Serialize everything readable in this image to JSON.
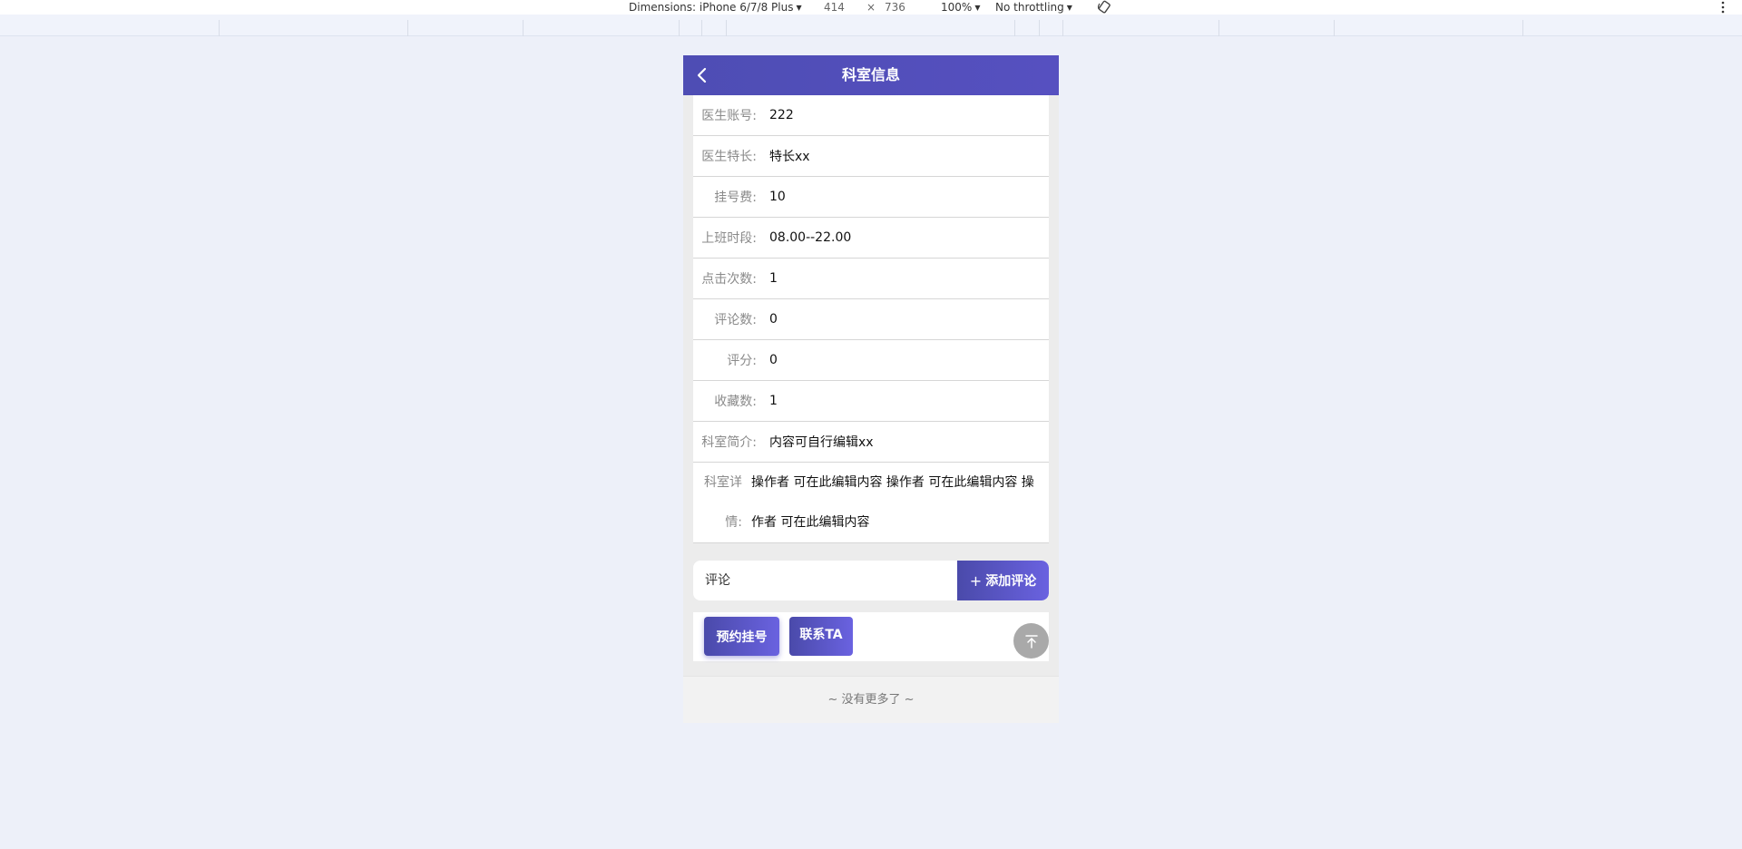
{
  "devtools": {
    "dimensions_label": "Dimensions: iPhone 6/7/8 Plus",
    "width": "414",
    "times": "×",
    "height": "736",
    "zoom": "100%",
    "throttling": "No throttling",
    "caret": "▼"
  },
  "header": {
    "title": "科室信息"
  },
  "details": {
    "rows": [
      {
        "label": "医生账号:",
        "value": "222"
      },
      {
        "label": "医生特长:",
        "value": "特长xx"
      },
      {
        "label": "挂号费:",
        "value": "10"
      },
      {
        "label": "上班时段:",
        "value": "08.00--22.00"
      },
      {
        "label": "点击次数:",
        "value": "1"
      },
      {
        "label": "评论数:",
        "value": "0"
      },
      {
        "label": "评分:",
        "value": "0"
      },
      {
        "label": "收藏数:",
        "value": "1"
      },
      {
        "label": "科室简介:",
        "value": "内容可自行编辑xx"
      }
    ],
    "detail_label": "科室详情:",
    "detail_value": "操作者 可在此编辑内容 操作者 可在此编辑内容 操作者 可在此编辑内容"
  },
  "comment": {
    "placeholder": "评论",
    "add_label": "添加评论",
    "add_icon": "plus-icon"
  },
  "actions": {
    "book_label": "预约挂号",
    "contact_label": "联系TA",
    "scroll_top_icon": "arrow-up-to-top-icon"
  },
  "footer": {
    "text": "~ 没有更多了 ~"
  },
  "colors": {
    "accent": "#4e4db4",
    "accent_light": "#6a62e0",
    "page_bg": "#edf0f9"
  }
}
